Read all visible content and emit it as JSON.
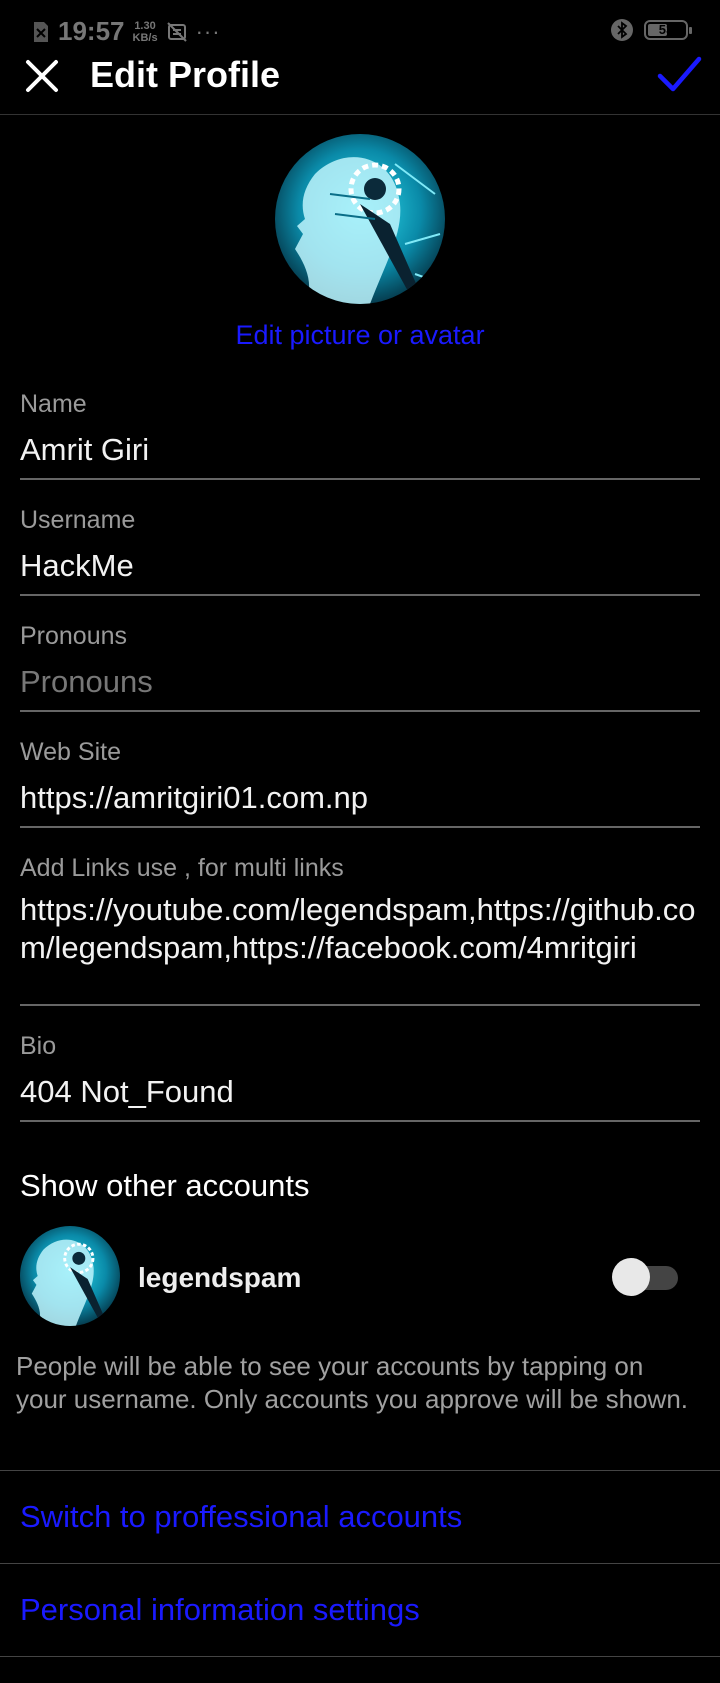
{
  "status_bar": {
    "time": "19:57",
    "net_speed_value": "1.30",
    "net_speed_unit": "KB/s",
    "more": "···",
    "battery": "53",
    "battery_level": 0.53
  },
  "header": {
    "title": "Edit Profile"
  },
  "profile": {
    "edit_picture_label": "Edit picture or avatar"
  },
  "fields": [
    {
      "label": "Name",
      "value": "Amrit Giri",
      "placeholder": ""
    },
    {
      "label": "Username",
      "value": "HackMe",
      "placeholder": ""
    },
    {
      "label": "Pronouns",
      "value": "",
      "placeholder": "Pronouns"
    },
    {
      "label": "Web Site",
      "value": "https://amritgiri01.com.np",
      "placeholder": ""
    },
    {
      "label": "Add Links use , for multi links",
      "value": "https://youtube.com/legendspam,https://github.com/legendspam,https://facebook.com/4mritgiri",
      "placeholder": ""
    },
    {
      "label": "Bio",
      "value": "404 Not_Found",
      "placeholder": ""
    }
  ],
  "other_accounts": {
    "title": "Show other accounts",
    "account_name": "legendspam",
    "toggle_on": false,
    "description": "People will be able to see your accounts by tapping on your username. Only accounts you approve will be shown."
  },
  "links": {
    "switch_professional": "Switch to proffessional accounts",
    "personal_info": "Personal information settings"
  },
  "colors": {
    "background": "#000000",
    "link": "#1a1aff",
    "accent_check": "#1a1aff",
    "avatar_cyan": "#19c3d8"
  }
}
